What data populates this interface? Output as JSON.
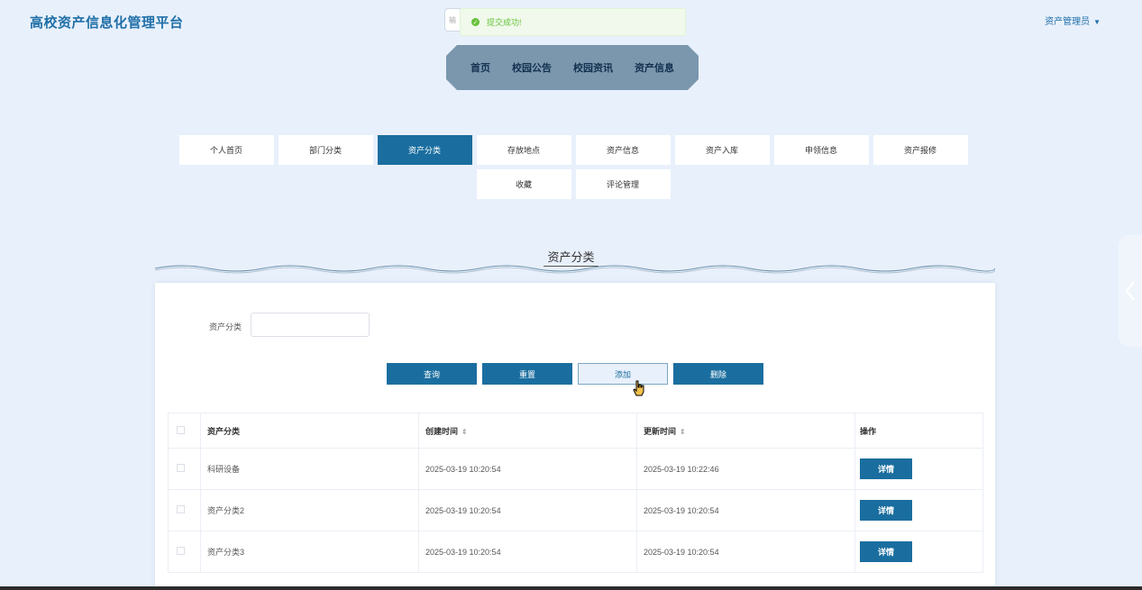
{
  "header": {
    "brand": "高校资产信息化管理平台",
    "user_menu": "资产管理员",
    "search_placeholder": "输"
  },
  "toast": {
    "message": "提交成功!"
  },
  "topnav": {
    "items": [
      "首页",
      "校园公告",
      "校园资讯",
      "资产信息"
    ]
  },
  "subnav": {
    "tabs": [
      "个人首页",
      "部门分类",
      "资产分类",
      "存放地点",
      "资产信息",
      "资产入库",
      "申领信息",
      "资产报修",
      "收藏",
      "评论管理"
    ],
    "active": "资产分类"
  },
  "section": {
    "title": "资产分类"
  },
  "filter": {
    "label": "资产分类",
    "value": ""
  },
  "actions": {
    "query": "查询",
    "reset": "重置",
    "add": "添加",
    "delete": "删除"
  },
  "table": {
    "columns": [
      "资产分类",
      "创建时间",
      "更新时间",
      "操作"
    ],
    "rows": [
      {
        "category": "科研设备",
        "created": "2025-03-19 10:20:54",
        "updated": "2025-03-19 10:22:46",
        "action": "详情"
      },
      {
        "category": "资产分类2",
        "created": "2025-03-19 10:20:54",
        "updated": "2025-03-19 10:20:54",
        "action": "详情"
      },
      {
        "category": "资产分类3",
        "created": "2025-03-19 10:20:54",
        "updated": "2025-03-19 10:20:54",
        "action": "详情"
      }
    ]
  },
  "colors": {
    "primary": "#1a6e9f",
    "background": "#e8f0fb",
    "nav_bg": "#7a97ae",
    "toast_text": "#67c23a"
  }
}
